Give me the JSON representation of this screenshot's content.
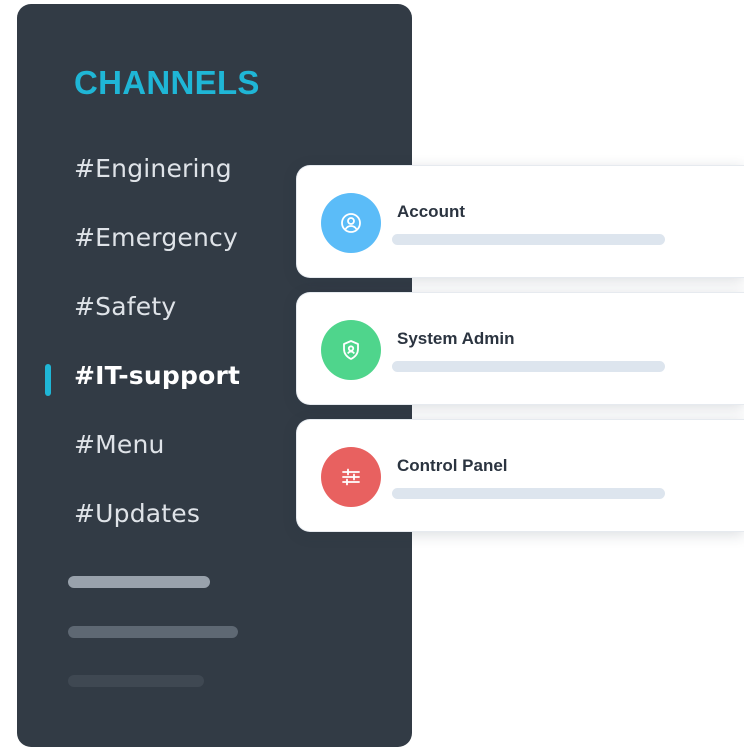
{
  "sidebar": {
    "title": "CHANNELS",
    "channels": [
      {
        "label": "#Enginering"
      },
      {
        "label": "#Emergency"
      },
      {
        "label": "#Safety"
      },
      {
        "label": "#IT-support",
        "active": true
      },
      {
        "label": "#Menu"
      },
      {
        "label": "#Updates"
      }
    ]
  },
  "cards": [
    {
      "label": "Account",
      "icon": "user-icon",
      "color": "#5bbcf8"
    },
    {
      "label": "System Admin",
      "icon": "shield-icon",
      "color": "#4fd58c"
    },
    {
      "label": "Control Panel",
      "icon": "sliders-icon",
      "color": "#e86160"
    }
  ],
  "colors": {
    "sidebar_bg": "#323b45",
    "accent": "#1fb6d6"
  }
}
